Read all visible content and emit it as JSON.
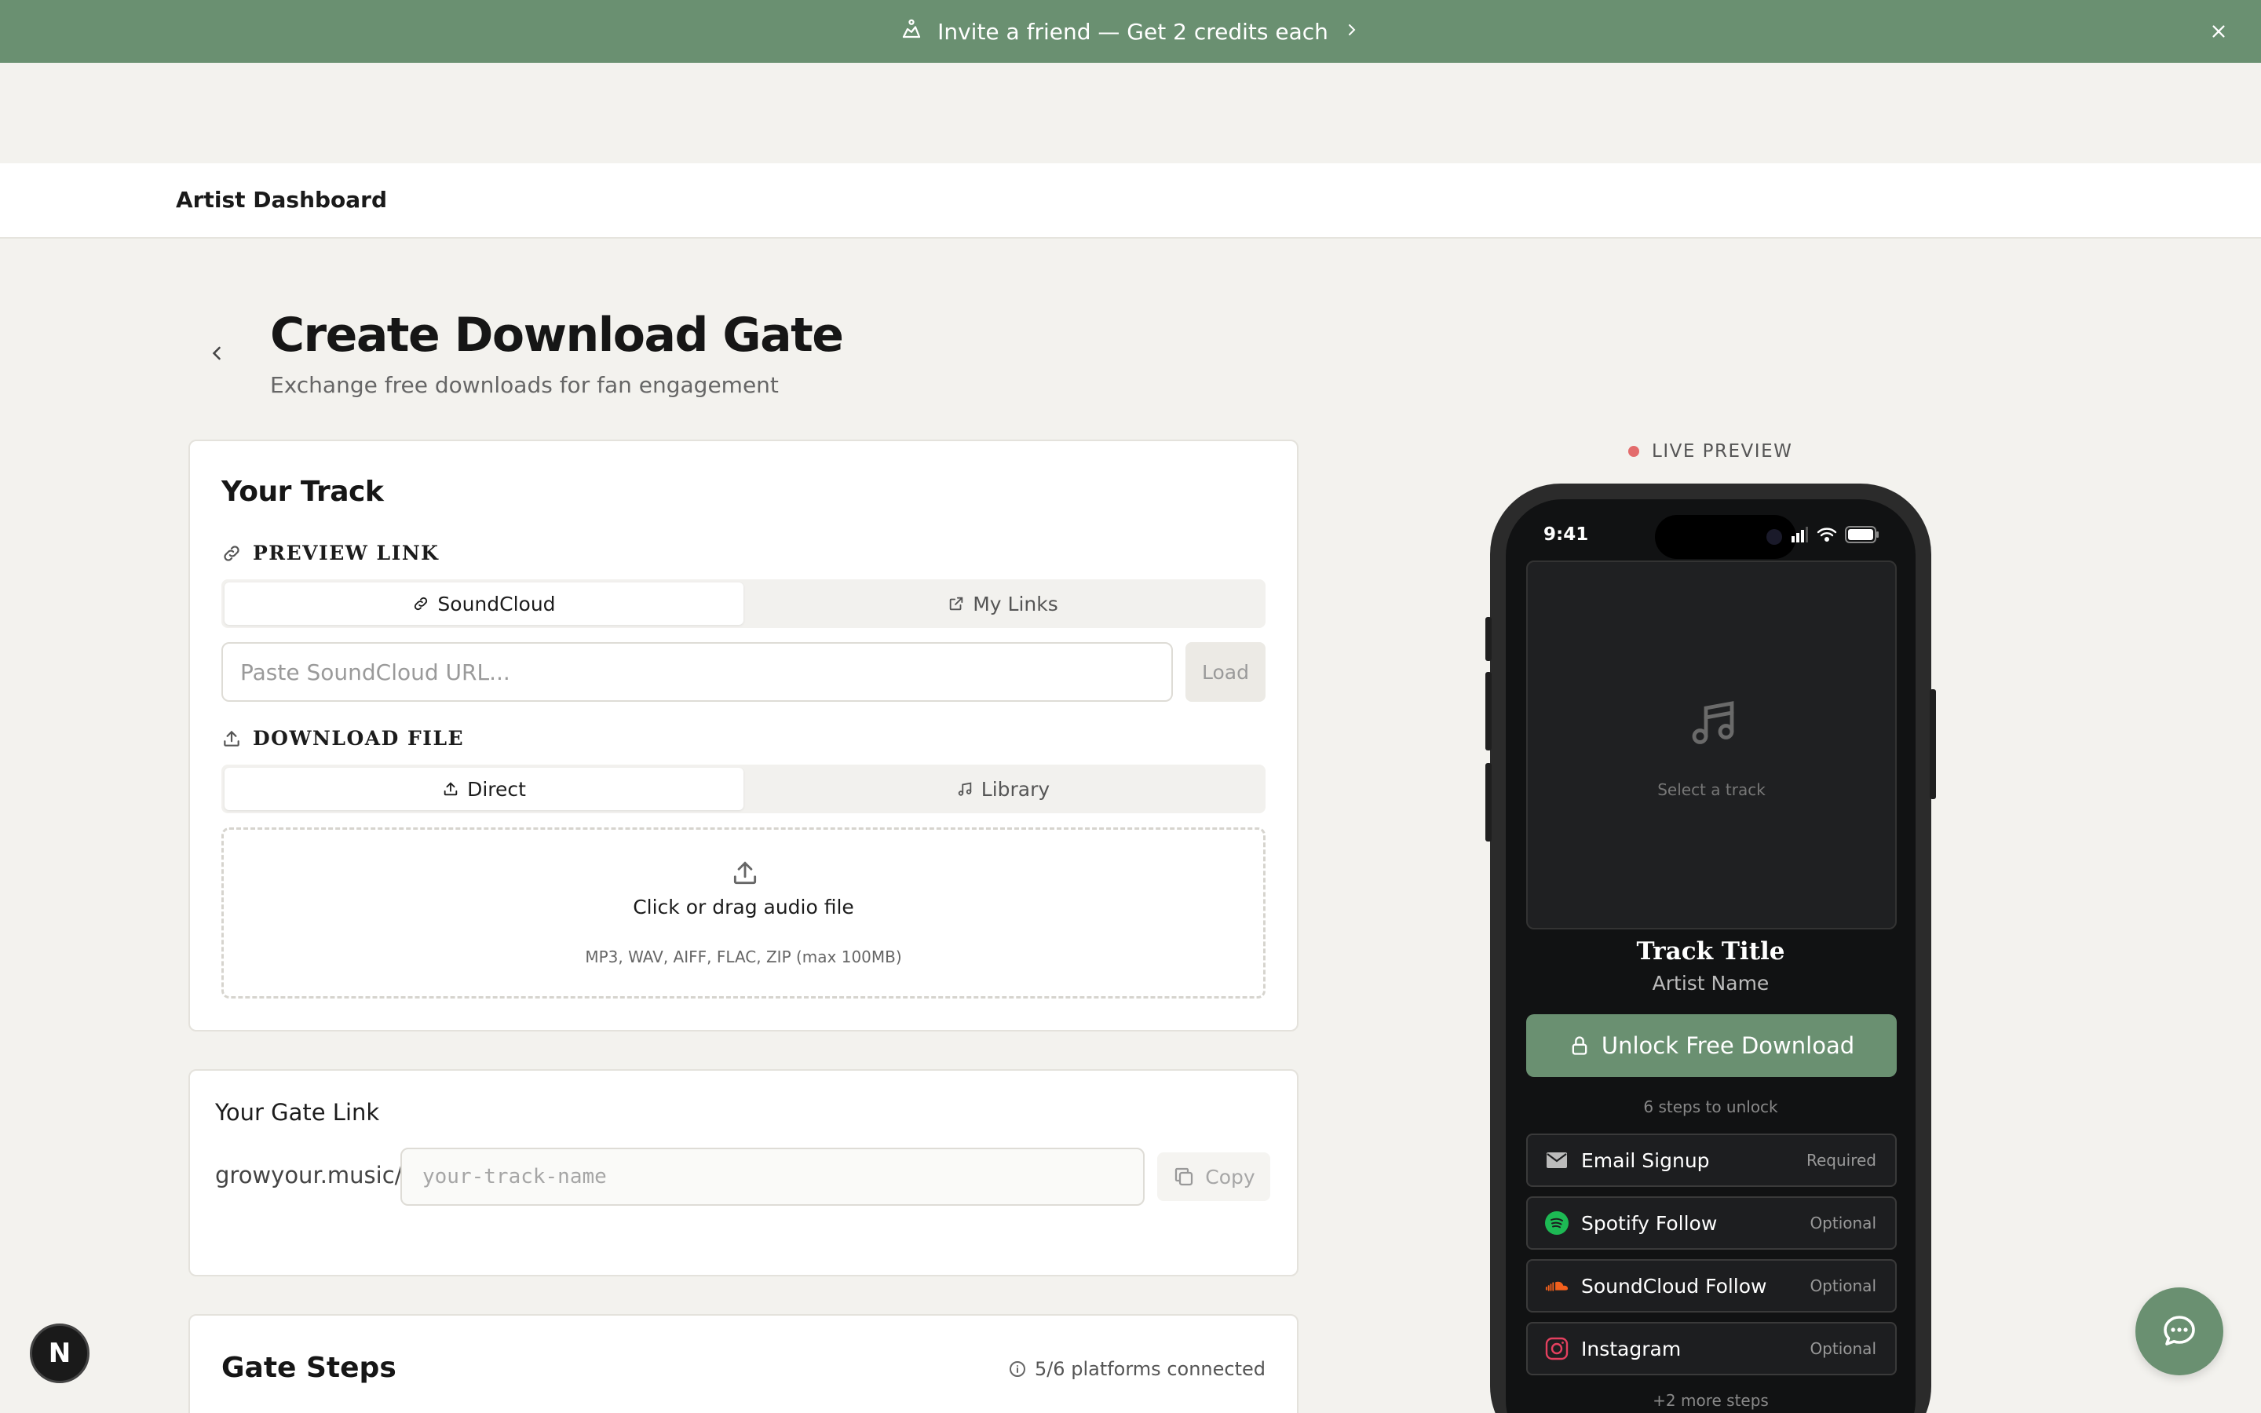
{
  "banner": {
    "text": "Invite a friend — Get 2 credits each"
  },
  "nav": {
    "brand": "Artist Dashboard"
  },
  "header": {
    "title": "Create Download Gate",
    "subtitle": "Exchange free downloads for fan engagement"
  },
  "track": {
    "heading": "Your Track",
    "preview_label": "PREVIEW LINK",
    "preview_tabs": [
      "SoundCloud",
      "My Links"
    ],
    "preview_active": "SoundCloud",
    "url_placeholder": "Paste SoundCloud URL...",
    "load_label": "Load",
    "download_label": "DOWNLOAD FILE",
    "download_tabs": [
      "Direct",
      "Library"
    ],
    "download_active": "Direct",
    "drop_main": "Click or drag audio file",
    "drop_sub": "MP3, WAV, AIFF, FLAC, ZIP (max 100MB)"
  },
  "gate_link": {
    "heading": "Your Gate Link",
    "prefix": "growyour.music/",
    "placeholder": "your-track-name",
    "copy_label": "Copy"
  },
  "gate_steps": {
    "heading": "Gate Steps",
    "meta": "5/6 platforms connected"
  },
  "preview": {
    "badge": "LIVE PREVIEW",
    "time": "9:41",
    "art_text": "Select a track",
    "track_title": "Track Title",
    "artist_name": "Artist Name",
    "unlock_label": "Unlock Free Download",
    "steps_count": "6 steps to unlock",
    "steps": [
      {
        "name": "Email Signup",
        "tag": "Required",
        "icon": "mail-icon"
      },
      {
        "name": "Spotify Follow",
        "tag": "Optional",
        "icon": "spotify-icon"
      },
      {
        "name": "SoundCloud Follow",
        "tag": "Optional",
        "icon": "soundcloud-icon"
      },
      {
        "name": "Instagram",
        "tag": "Optional",
        "icon": "instagram-icon"
      }
    ],
    "more": "+2 more steps"
  },
  "colors": {
    "accent": "#6a9071",
    "bg": "#f3f2ee",
    "live": "#e36c6c"
  },
  "dev_badge": "N"
}
